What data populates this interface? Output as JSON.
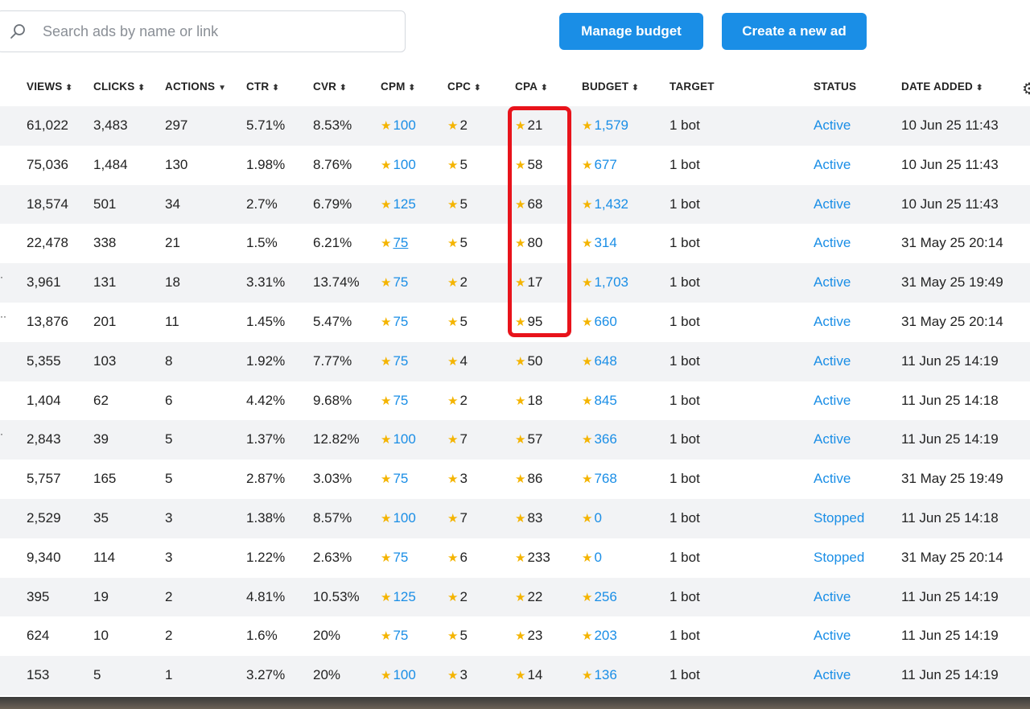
{
  "search": {
    "placeholder": "Search ads by name or link",
    "value": ""
  },
  "buttons": {
    "manage_budget": "Manage budget",
    "create_ad": "Create a new ad"
  },
  "columns": [
    {
      "label": "VIEWS",
      "sort": "⬍"
    },
    {
      "label": "CLICKS",
      "sort": "⬍"
    },
    {
      "label": "ACTIONS",
      "sort": "▼"
    },
    {
      "label": "CTR",
      "sort": "⬍"
    },
    {
      "label": "CVR",
      "sort": "⬍"
    },
    {
      "label": "CPM",
      "sort": "⬍"
    },
    {
      "label": "CPC",
      "sort": "⬍"
    },
    {
      "label": "CPA",
      "sort": "⬍"
    },
    {
      "label": "BUDGET",
      "sort": "⬍"
    },
    {
      "label": "TARGET",
      "sort": ""
    },
    {
      "label": "STATUS",
      "sort": ""
    },
    {
      "label": "DATE ADDED",
      "sort": "⬍"
    }
  ],
  "rows": [
    {
      "views": "61,022",
      "clicks": "3,483",
      "actions": "297",
      "ctr": "5.71%",
      "cvr": "8.53%",
      "cpm": "100",
      "cpc": "2",
      "cpa": "21",
      "budget": "1,579",
      "target": "1 bot",
      "status": "Active",
      "date": "10 Jun 25 11:43"
    },
    {
      "views": "75,036",
      "clicks": "1,484",
      "actions": "130",
      "ctr": "1.98%",
      "cvr": "8.76%",
      "cpm": "100",
      "cpc": "5",
      "cpa": "58",
      "budget": "677",
      "target": "1 bot",
      "status": "Active",
      "date": "10 Jun 25 11:43"
    },
    {
      "views": "18,574",
      "clicks": "501",
      "actions": "34",
      "ctr": "2.7%",
      "cvr": "6.79%",
      "cpm": "125",
      "cpc": "5",
      "cpa": "68",
      "budget": "1,432",
      "target": "1 bot",
      "status": "Active",
      "date": "10 Jun 25 11:43"
    },
    {
      "views": "22,478",
      "clicks": "338",
      "actions": "21",
      "ctr": "1.5%",
      "cvr": "6.21%",
      "cpm": "75",
      "cpc": "5",
      "cpa": "80",
      "budget": "314",
      "target": "1 bot",
      "status": "Active",
      "date": "31 May 25 20:14"
    },
    {
      "views": "3,961",
      "clicks": "131",
      "actions": "18",
      "ctr": "3.31%",
      "cvr": "13.74%",
      "cpm": "75",
      "cpc": "2",
      "cpa": "17",
      "budget": "1,703",
      "target": "1 bot",
      "status": "Active",
      "date": "31 May 25 19:49"
    },
    {
      "views": "13,876",
      "clicks": "201",
      "actions": "11",
      "ctr": "1.45%",
      "cvr": "5.47%",
      "cpm": "75",
      "cpc": "5",
      "cpa": "95",
      "budget": "660",
      "target": "1 bot",
      "status": "Active",
      "date": "31 May 25 20:14"
    },
    {
      "views": "5,355",
      "clicks": "103",
      "actions": "8",
      "ctr": "1.92%",
      "cvr": "7.77%",
      "cpm": "75",
      "cpc": "4",
      "cpa": "50",
      "budget": "648",
      "target": "1 bot",
      "status": "Active",
      "date": "11 Jun 25 14:19"
    },
    {
      "views": "1,404",
      "clicks": "62",
      "actions": "6",
      "ctr": "4.42%",
      "cvr": "9.68%",
      "cpm": "75",
      "cpc": "2",
      "cpa": "18",
      "budget": "845",
      "target": "1 bot",
      "status": "Active",
      "date": "11 Jun 25 14:18"
    },
    {
      "views": "2,843",
      "clicks": "39",
      "actions": "5",
      "ctr": "1.37%",
      "cvr": "12.82%",
      "cpm": "100",
      "cpc": "7",
      "cpa": "57",
      "budget": "366",
      "target": "1 bot",
      "status": "Active",
      "date": "11 Jun 25 14:19"
    },
    {
      "views": "5,757",
      "clicks": "165",
      "actions": "5",
      "ctr": "2.87%",
      "cvr": "3.03%",
      "cpm": "75",
      "cpc": "3",
      "cpa": "86",
      "budget": "768",
      "target": "1 bot",
      "status": "Active",
      "date": "31 May 25 19:49"
    },
    {
      "views": "2,529",
      "clicks": "35",
      "actions": "3",
      "ctr": "1.38%",
      "cvr": "8.57%",
      "cpm": "100",
      "cpc": "7",
      "cpa": "83",
      "budget": "0",
      "target": "1 bot",
      "status": "Stopped",
      "date": "11 Jun 25 14:18"
    },
    {
      "views": "9,340",
      "clicks": "114",
      "actions": "3",
      "ctr": "1.22%",
      "cvr": "2.63%",
      "cpm": "75",
      "cpc": "6",
      "cpa": "233",
      "budget": "0",
      "target": "1 bot",
      "status": "Stopped",
      "date": "31 May 25 20:14"
    },
    {
      "views": "395",
      "clicks": "19",
      "actions": "2",
      "ctr": "4.81%",
      "cvr": "10.53%",
      "cpm": "125",
      "cpc": "2",
      "cpa": "22",
      "budget": "256",
      "target": "1 bot",
      "status": "Active",
      "date": "11 Jun 25 14:19"
    },
    {
      "views": "624",
      "clicks": "10",
      "actions": "2",
      "ctr": "1.6%",
      "cvr": "20%",
      "cpm": "75",
      "cpc": "5",
      "cpa": "23",
      "budget": "203",
      "target": "1 bot",
      "status": "Active",
      "date": "11 Jun 25 14:19"
    },
    {
      "views": "153",
      "clicks": "5",
      "actions": "1",
      "ctr": "3.27%",
      "cvr": "20%",
      "cpm": "100",
      "cpc": "3",
      "cpa": "14",
      "budget": "136",
      "target": "1 bot",
      "status": "Active",
      "date": "11 Jun 25 14:19"
    }
  ],
  "icons": {
    "star": "★",
    "search": "search-icon",
    "settings": "gear-icon",
    "row_menu": "⋮"
  },
  "colors": {
    "accent": "#1a8ee6",
    "star": "#f4b400",
    "highlight": "#e8131b"
  }
}
